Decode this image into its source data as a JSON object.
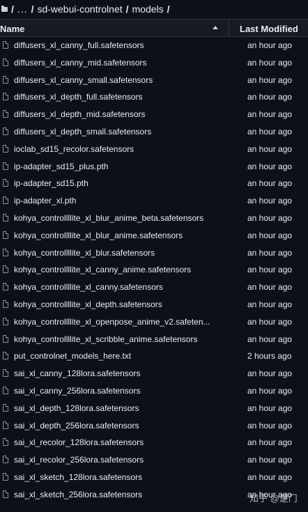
{
  "breadcrumb": {
    "root": "/",
    "ellipsis": "...",
    "folder": "sd-webui-controlnet",
    "subfolder": "models",
    "separator": "/"
  },
  "table": {
    "columns": {
      "name": "Name",
      "modified": "Last Modified"
    },
    "rows": [
      {
        "name": "diffusers_xl_canny_full.safetensors",
        "modified": "an hour ago"
      },
      {
        "name": "diffusers_xl_canny_mid.safetensors",
        "modified": "an hour ago"
      },
      {
        "name": "diffusers_xl_canny_small.safetensors",
        "modified": "an hour ago"
      },
      {
        "name": "diffusers_xl_depth_full.safetensors",
        "modified": "an hour ago"
      },
      {
        "name": "diffusers_xl_depth_mid.safetensors",
        "modified": "an hour ago"
      },
      {
        "name": "diffusers_xl_depth_small.safetensors",
        "modified": "an hour ago"
      },
      {
        "name": "ioclab_sd15_recolor.safetensors",
        "modified": "an hour ago"
      },
      {
        "name": "ip-adapter_sd15_plus.pth",
        "modified": "an hour ago"
      },
      {
        "name": "ip-adapter_sd15.pth",
        "modified": "an hour ago"
      },
      {
        "name": "ip-adapter_xl.pth",
        "modified": "an hour ago"
      },
      {
        "name": "kohya_controllllite_xl_blur_anime_beta.safetensors",
        "modified": "an hour ago"
      },
      {
        "name": "kohya_controllllite_xl_blur_anime.safetensors",
        "modified": "an hour ago"
      },
      {
        "name": "kohya_controllllite_xl_blur.safetensors",
        "modified": "an hour ago"
      },
      {
        "name": "kohya_controllllite_xl_canny_anime.safetensors",
        "modified": "an hour ago"
      },
      {
        "name": "kohya_controllllite_xl_canny.safetensors",
        "modified": "an hour ago"
      },
      {
        "name": "kohya_controllllite_xl_depth.safetensors",
        "modified": "an hour ago"
      },
      {
        "name": "kohya_controllllite_xl_openpose_anime_v2.safeten...",
        "modified": "an hour ago"
      },
      {
        "name": "kohya_controllllite_xl_scribble_anime.safetensors",
        "modified": "an hour ago"
      },
      {
        "name": "put_controlnet_models_here.txt",
        "modified": "2 hours ago"
      },
      {
        "name": "sai_xl_canny_128lora.safetensors",
        "modified": "an hour ago"
      },
      {
        "name": "sai_xl_canny_256lora.safetensors",
        "modified": "an hour ago"
      },
      {
        "name": "sai_xl_depth_128lora.safetensors",
        "modified": "an hour ago"
      },
      {
        "name": "sai_xl_depth_256lora.safetensors",
        "modified": "an hour ago"
      },
      {
        "name": "sai_xl_recolor_128lora.safetensors",
        "modified": "an hour ago"
      },
      {
        "name": "sai_xl_recolor_256lora.safetensors",
        "modified": "an hour ago"
      },
      {
        "name": "sai_xl_sketch_128lora.safetensors",
        "modified": "an hour ago"
      },
      {
        "name": "sai_xl_sketch_256lora.safetensors",
        "modified": "an hour ago"
      }
    ]
  },
  "watermark": "知乎 @楚门",
  "colors": {
    "background": "#0d1117",
    "header_bg": "#161b22",
    "border": "#30363d",
    "text": "#e6edf3",
    "icon": "#8b949e"
  }
}
